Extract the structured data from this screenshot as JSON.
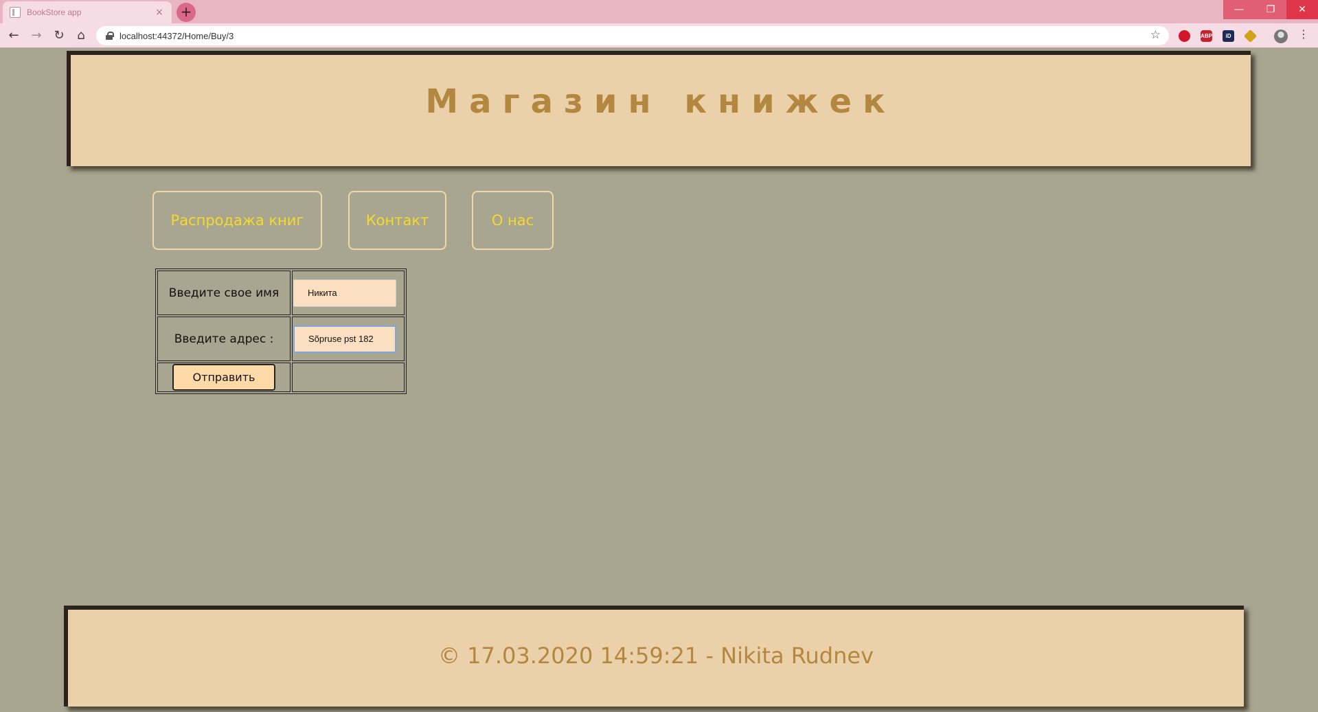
{
  "browser": {
    "tab_title": "BookStore app",
    "tab_close": "×",
    "new_tab": "+",
    "url": "localhost:44372/Home/Buy/3",
    "window_controls": {
      "minimize": "—",
      "maximize": "❐",
      "close": "✕"
    },
    "nav_icons": {
      "back": "←",
      "forward": "→",
      "reload": "↻",
      "home": "⌂",
      "star": "☆",
      "menu": "⋮"
    },
    "extensions": {
      "abp": "ABP",
      "id": "iD"
    }
  },
  "header": {
    "title": "Магазин книжек"
  },
  "nav": {
    "sale": "Распродажа книг",
    "contact": "Контакт",
    "about": "О нас"
  },
  "form": {
    "name_label": "Введите свое имя",
    "name_value": "Никита",
    "address_label": "Введите адрес :",
    "address_value": "Sõpruse pst 182",
    "submit_label": "Отправить"
  },
  "footer": {
    "text": "© 17.03.2020 14:59:21 - Nikita Rudnev"
  },
  "colors": {
    "page_bg": "#a8a690",
    "panel_bg": "#ebd1a9",
    "title_color": "#b3873f",
    "nav_text": "#f4da2a",
    "input_bg": "#fbdfc0",
    "button_bg": "#ffd9a6"
  }
}
